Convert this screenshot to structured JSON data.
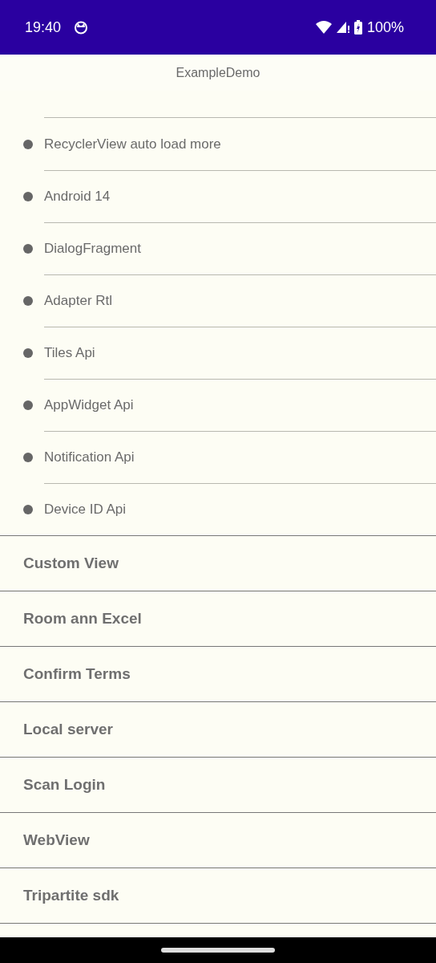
{
  "status_bar": {
    "time": "19:40",
    "battery": "100%"
  },
  "app_bar": {
    "title": "ExampleDemo"
  },
  "sub_items": [
    {
      "label": "RecyclerView auto load more"
    },
    {
      "label": "Android 14"
    },
    {
      "label": "DialogFragment"
    },
    {
      "label": "Adapter Rtl"
    },
    {
      "label": "Tiles Api"
    },
    {
      "label": "AppWidget Api"
    },
    {
      "label": "Notification Api"
    },
    {
      "label": "Device ID Api"
    }
  ],
  "sections": [
    {
      "label": "Custom View"
    },
    {
      "label": "Room ann Excel"
    },
    {
      "label": "Confirm Terms"
    },
    {
      "label": "Local server"
    },
    {
      "label": "Scan Login"
    },
    {
      "label": "WebView"
    },
    {
      "label": "Tripartite sdk"
    }
  ]
}
